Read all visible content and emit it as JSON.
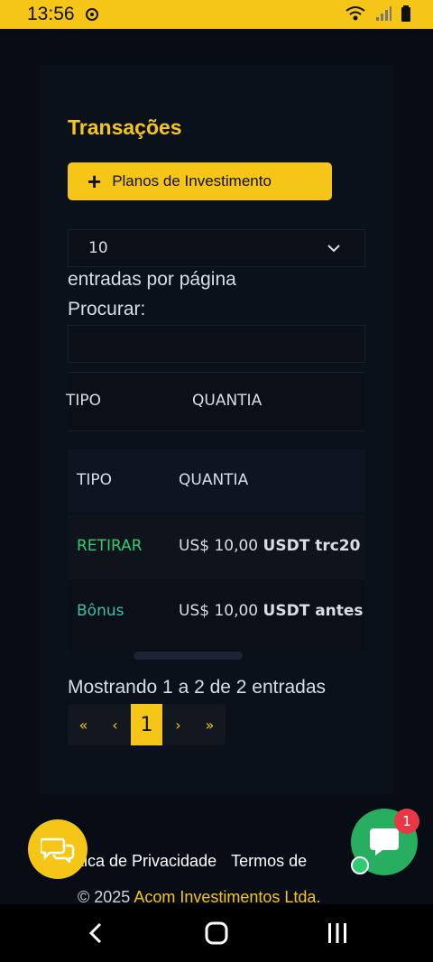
{
  "status_bar": {
    "time": "13:56",
    "icons": [
      "notification-icon",
      "wifi-icon",
      "signal-icon",
      "battery-icon"
    ]
  },
  "page": {
    "title": "Transações",
    "plan_button": "Planos de Investimento",
    "entries_select": {
      "value": "10"
    },
    "entries_label": "entradas por página",
    "search_label": "Procurar:",
    "search_value": ""
  },
  "table": {
    "columns": [
      "TIPO",
      "QUANTIA"
    ],
    "rows": [
      {
        "type": "RETIRAR",
        "amount": "US$ 10,00",
        "currency": "USDT trc20",
        "type_color": "#2ecc71"
      },
      {
        "type": "Bônus",
        "amount": "US$ 10,00",
        "currency": "USDT antes d",
        "type_color": "#3fbfa6"
      }
    ],
    "info": "Mostrando 1 a 2 de 2 entradas",
    "pagination": {
      "first": "«",
      "prev": "‹",
      "current": "1",
      "next": "›",
      "last": "»"
    }
  },
  "footer": {
    "privacy": "tica de Privacidade",
    "terms": "Termos de",
    "copyright_prefix": "© 2025",
    "company": "Acom Investimentos Ltda."
  },
  "chat": {
    "unread_count": "1"
  },
  "colors": {
    "accent": "#f5c518",
    "background": "#070c15",
    "success": "#27ae60",
    "badge": "#e63946"
  }
}
